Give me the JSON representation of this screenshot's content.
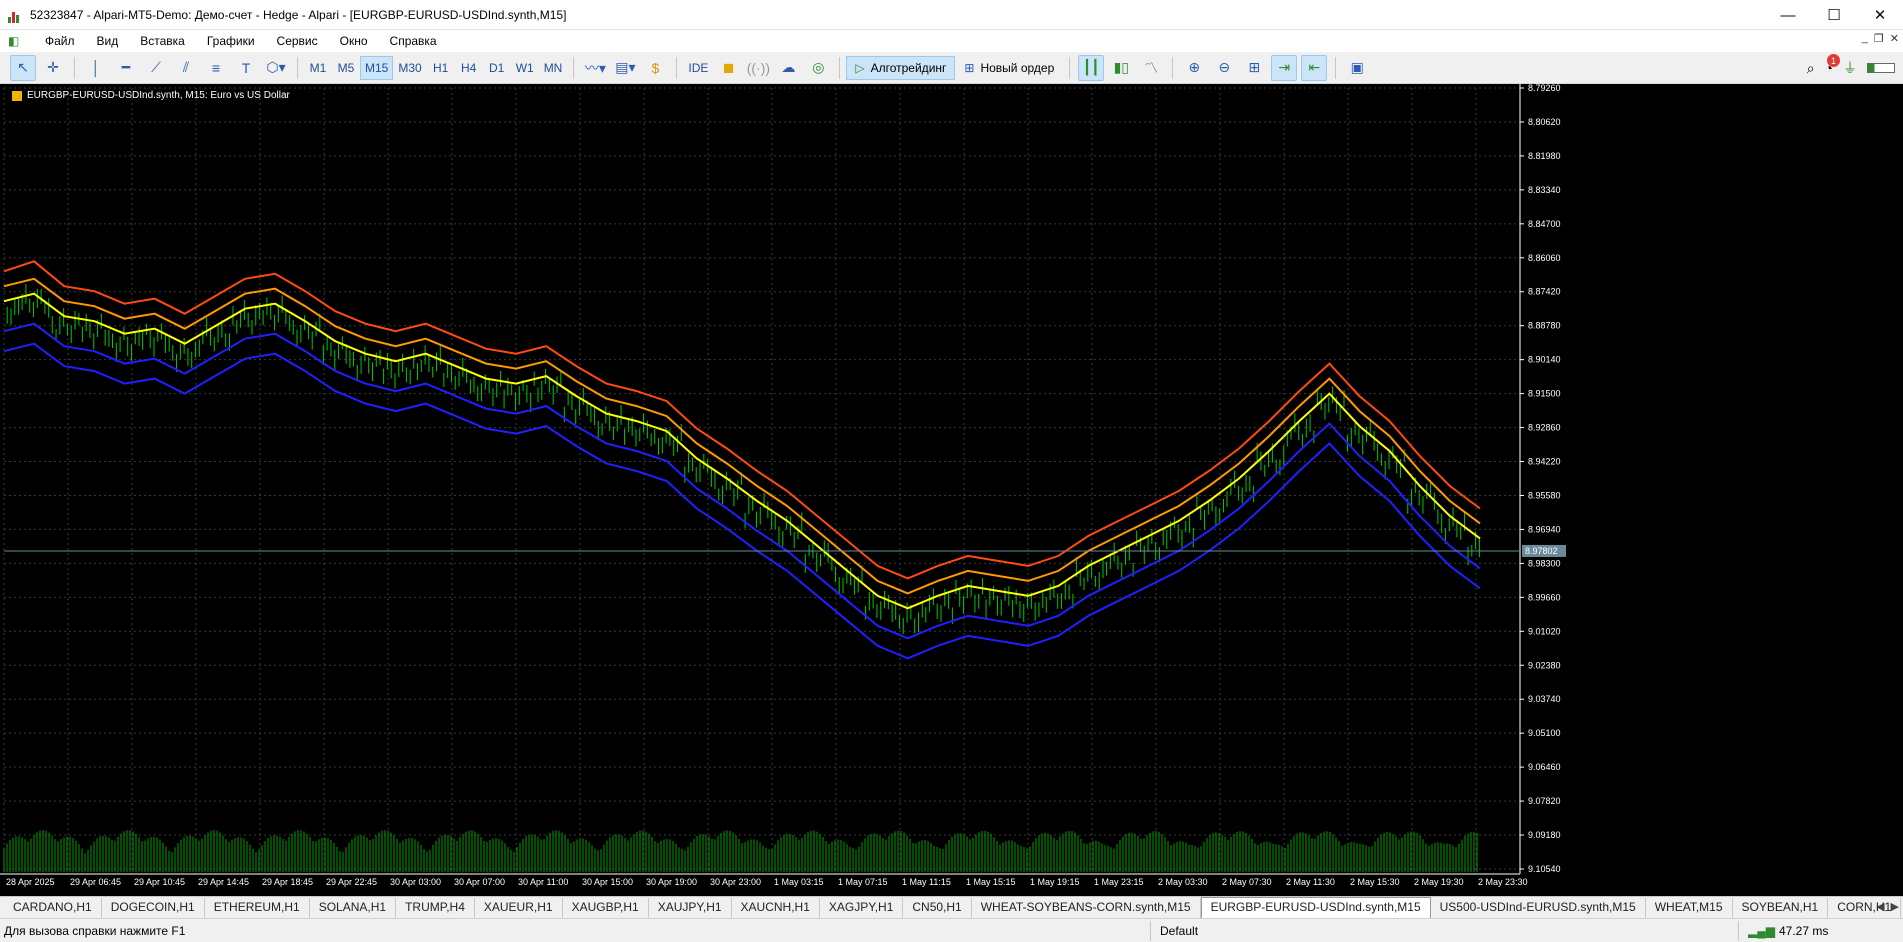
{
  "window": {
    "title": "52323847 - Alpari-MT5-Demo: Демо-счет - Hedge - Alpari - [EURGBP-EURUSD-USDInd.synth,M15]",
    "controls": {
      "minimize": "—",
      "maximize": "☐",
      "close": "✕"
    }
  },
  "menu": {
    "items": [
      "Файл",
      "Вид",
      "Вставка",
      "Графики",
      "Сервис",
      "Окно",
      "Справка"
    ]
  },
  "toolbar": {
    "timeframes": [
      "M1",
      "M5",
      "M15",
      "M30",
      "H1",
      "H4",
      "D1",
      "W1",
      "MN"
    ],
    "active_timeframe": "M15",
    "ide_label": "IDE",
    "algo_label": "Алготрейдинг",
    "new_order_label": "Новый ордер",
    "notification_count": "1"
  },
  "chart": {
    "symbol_caption": "EURGBP-EURUSD-USDInd.synth, M15:  Euro vs US Dollar",
    "current_price": "8.97802",
    "price_labels": [
      "8.79260",
      "8.80620",
      "8.81980",
      "8.83340",
      "8.84700",
      "8.86060",
      "8.87420",
      "8.88780",
      "8.90140",
      "8.91500",
      "8.92860",
      "8.94220",
      "8.95580",
      "8.96940",
      "8.98300",
      "8.99660",
      "9.01020",
      "9.02380",
      "9.03740",
      "9.05100",
      "9.06460",
      "9.07820",
      "9.09180",
      "9.10540"
    ],
    "time_labels": [
      "28 Apr 2025",
      "29 Apr 06:45",
      "29 Apr 10:45",
      "29 Apr 14:45",
      "29 Apr 18:45",
      "29 Apr 22:45",
      "30 Apr 03:00",
      "30 Apr 07:00",
      "30 Apr 11:00",
      "30 Apr 15:00",
      "30 Apr 19:00",
      "30 Apr 23:00",
      "1 May 03:15",
      "1 May 07:15",
      "1 May 11:15",
      "1 May 15:15",
      "1 May 19:15",
      "1 May 23:15",
      "2 May 03:30",
      "2 May 07:30",
      "2 May 11:30",
      "2 May 15:30",
      "2 May 19:30",
      "2 May 23:30"
    ],
    "colors": {
      "background": "#000000",
      "grid": "#3a3a3a",
      "price": "#00c800",
      "upper_band": "#ff4a12",
      "mid_upper": "#ff9a00",
      "middle": "#ffff00",
      "lower": "#2020ff",
      "volume": "#00a000",
      "axis_text": "#ffffff"
    }
  },
  "chart_data": {
    "type": "line",
    "y_axis": "price (inverted scale, 8.7926 top to 9.1054 bottom)",
    "ylim": [
      9.1054,
      8.7926
    ],
    "series": [
      {
        "values": [
          8.882,
          8.8785,
          8.888,
          8.89,
          8.895,
          8.893,
          8.899,
          8.892,
          8.885,
          8.883,
          8.89,
          8.898,
          8.903,
          8.906,
          8.903,
          8.908,
          8.913,
          8.915,
          8.912,
          8.92,
          8.927,
          8.93,
          8.934,
          8.945,
          8.953,
          8.962,
          8.97,
          8.98,
          8.99,
          9.0,
          9.005,
          9.0,
          8.996,
          8.998,
          9.0,
          8.996,
          8.988,
          8.982,
          8.976,
          8.97,
          8.962,
          8.953,
          8.942,
          8.93,
          8.919,
          8.932,
          8.942,
          8.956,
          8.968,
          8.977
        ]
      },
      {
        "values": [
          8.866,
          8.862,
          8.872,
          8.874,
          8.879,
          8.877,
          8.883,
          8.876,
          8.869,
          8.867,
          8.874,
          8.882,
          8.887,
          8.89,
          8.887,
          8.892,
          8.897,
          8.899,
          8.896,
          8.904,
          8.911,
          8.914,
          8.918,
          8.929,
          8.937,
          8.946,
          8.954,
          8.964,
          8.974,
          8.984,
          8.989,
          8.984,
          8.98,
          8.982,
          8.984,
          8.98,
          8.972,
          8.966,
          8.96,
          8.954,
          8.946,
          8.937,
          8.926,
          8.914,
          8.903,
          8.916,
          8.926,
          8.94,
          8.952,
          8.961
        ]
      },
      {
        "values": [
          8.872,
          8.869,
          8.878,
          8.88,
          8.885,
          8.883,
          8.889,
          8.882,
          8.875,
          8.873,
          8.88,
          8.888,
          8.893,
          8.896,
          8.893,
          8.898,
          8.903,
          8.905,
          8.902,
          8.91,
          8.917,
          8.92,
          8.924,
          8.935,
          8.943,
          8.952,
          8.96,
          8.97,
          8.98,
          8.99,
          8.995,
          8.99,
          8.986,
          8.988,
          8.99,
          8.986,
          8.978,
          8.972,
          8.966,
          8.96,
          8.952,
          8.943,
          8.932,
          8.92,
          8.909,
          8.922,
          8.932,
          8.946,
          8.958,
          8.967
        ]
      },
      {
        "values": [
          8.878,
          8.875,
          8.884,
          8.886,
          8.891,
          8.889,
          8.895,
          8.888,
          8.881,
          8.879,
          8.886,
          8.894,
          8.899,
          8.902,
          8.899,
          8.904,
          8.909,
          8.911,
          8.908,
          8.916,
          8.923,
          8.926,
          8.93,
          8.941,
          8.949,
          8.958,
          8.966,
          8.976,
          8.986,
          8.996,
          9.001,
          8.996,
          8.992,
          8.994,
          8.996,
          8.992,
          8.984,
          8.978,
          8.972,
          8.966,
          8.958,
          8.949,
          8.938,
          8.926,
          8.915,
          8.928,
          8.938,
          8.952,
          8.964,
          8.973
        ]
      },
      {
        "values": [
          8.89,
          8.887,
          8.896,
          8.898,
          8.903,
          8.901,
          8.907,
          8.9,
          8.893,
          8.891,
          8.898,
          8.906,
          8.911,
          8.914,
          8.911,
          8.916,
          8.921,
          8.923,
          8.92,
          8.928,
          8.935,
          8.938,
          8.942,
          8.953,
          8.961,
          8.97,
          8.978,
          8.988,
          8.998,
          9.008,
          9.013,
          9.008,
          9.004,
          9.006,
          9.008,
          9.004,
          8.996,
          8.99,
          8.984,
          8.978,
          8.97,
          8.961,
          8.95,
          8.938,
          8.927,
          8.94,
          8.95,
          8.964,
          8.976,
          8.985
        ]
      },
      {
        "values": [
          8.898,
          8.895,
          8.904,
          8.906,
          8.911,
          8.909,
          8.915,
          8.908,
          8.901,
          8.899,
          8.906,
          8.914,
          8.919,
          8.922,
          8.919,
          8.924,
          8.929,
          8.931,
          8.928,
          8.936,
          8.943,
          8.946,
          8.95,
          8.961,
          8.969,
          8.978,
          8.986,
          8.996,
          9.006,
          9.016,
          9.021,
          9.016,
          9.012,
          9.014,
          9.016,
          9.012,
          9.004,
          8.998,
          8.992,
          8.986,
          8.978,
          8.969,
          8.958,
          8.946,
          8.935,
          8.948,
          8.958,
          8.972,
          8.984,
          8.993
        ]
      }
    ],
    "grid": true
  },
  "tabs": [
    "CARDANO,H1",
    "DOGECOIN,H1",
    "ETHEREUM,H1",
    "SOLANA,H1",
    "TRUMP,H4",
    "XAUEUR,H1",
    "XAUGBP,H1",
    "XAUJPY,H1",
    "XAUCNH,H1",
    "XAGJPY,H1",
    "CN50,H1",
    "WHEAT-SOYBEANS-CORN.synth,M15",
    "EURGBP-EURUSD-USDInd.synth,M15",
    "US500-USDInd-EURUSD.synth,M15",
    "WHEAT,M15",
    "SOYBEAN,H1",
    "CORN,H1"
  ],
  "active_tab_index": 12,
  "status": {
    "help": "Для вызова справки нажмите F1",
    "profile": "Default",
    "ping": "47.27 ms"
  }
}
